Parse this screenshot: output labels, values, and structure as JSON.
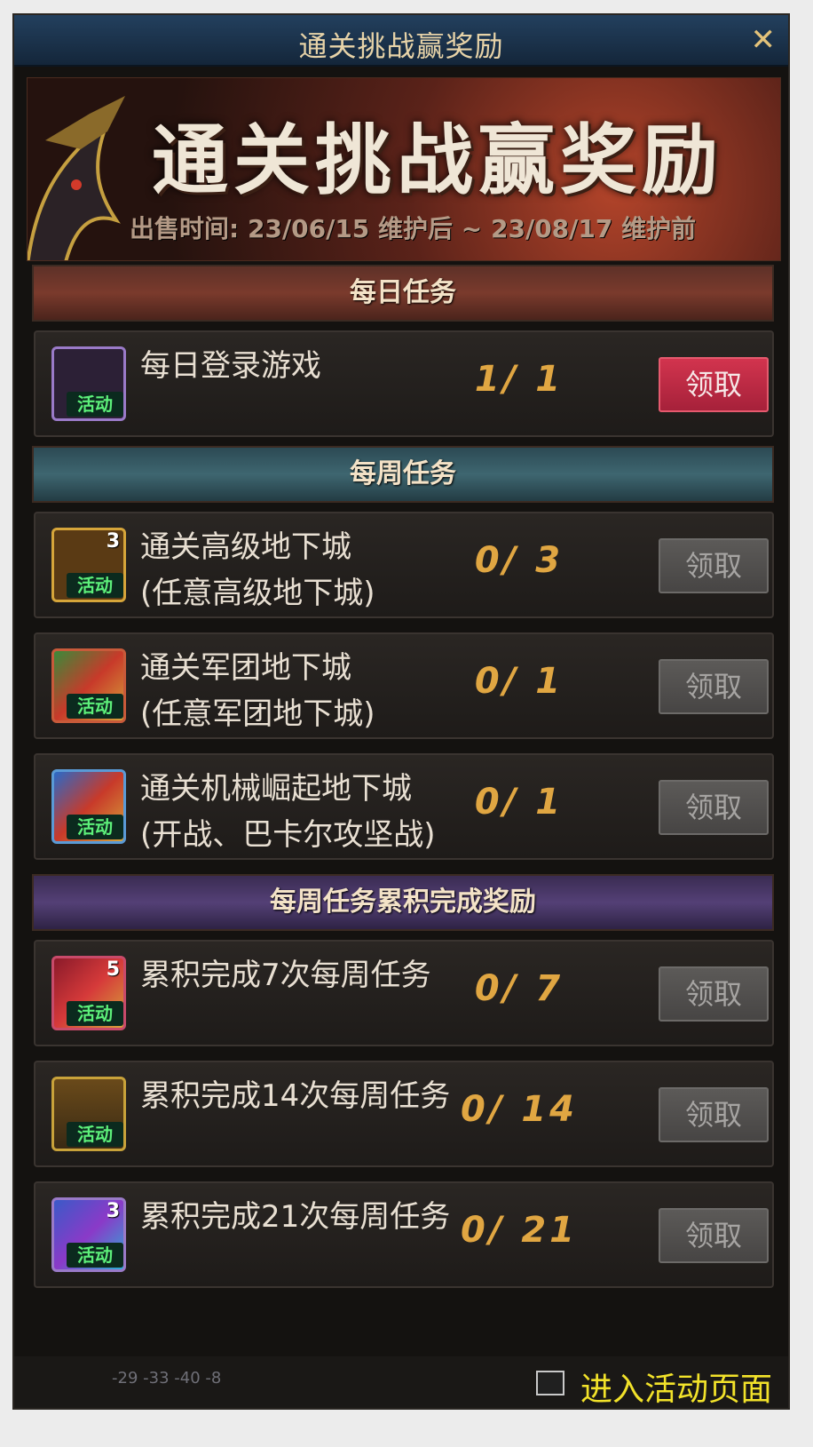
{
  "window": {
    "title": "通关挑战赢奖励",
    "close_glyph": "✕"
  },
  "banner": {
    "title": "通关挑战赢奖励",
    "sale_period": "出售时间: 23/06/15 维护后 ~ 23/08/17 维护前"
  },
  "sections": [
    {
      "title": "每日任务"
    },
    {
      "title": "每周任务"
    },
    {
      "title": "每周任务累积完成奖励"
    }
  ],
  "tasks": [
    {
      "name": "每日登录游戏",
      "sub": "",
      "progress": "1/ 1",
      "button": "领取",
      "icon": "purple-box-icon",
      "badge": "活动",
      "count": ""
    },
    {
      "name": "通关高级地下城",
      "sub": "(任意高级地下城)",
      "progress": "0/ 3",
      "button": "领取",
      "icon": "gold-chest-icon",
      "badge": "活动",
      "count": "3"
    },
    {
      "name": "通关军团地下城",
      "sub": "(任意军团地下城)",
      "progress": "0/ 1",
      "button": "领取",
      "icon": "rainbow-gem-icon",
      "badge": "活动",
      "count": ""
    },
    {
      "name": "通关机械崛起地下城",
      "sub": "(开战、巴卡尔攻坚战)",
      "progress": "0/ 1",
      "button": "领取",
      "icon": "blue-gem-icon",
      "badge": "活动",
      "count": ""
    },
    {
      "name": "累积完成7次每周任务",
      "sub": "",
      "progress": "0/ 7",
      "button": "领取",
      "icon": "red-card-icon",
      "badge": "活动",
      "count": "5"
    },
    {
      "name": "累积完成14次每周任务",
      "sub": "",
      "progress": "0/ 14",
      "button": "领取",
      "icon": "gold-box-icon",
      "badge": "活动",
      "count": ""
    },
    {
      "name": "累积完成21次每周任务",
      "sub": "",
      "progress": "0/ 21",
      "button": "领取",
      "icon": "blue-box-icon",
      "badge": "活动",
      "count": "3"
    }
  ],
  "footer": {
    "enter_label": "进入活动页面",
    "hotbar_text": "-29  -33  -40  -8"
  },
  "colors": {
    "claim_active": "#c62a44",
    "claim_inactive": "#555352",
    "progress": "#e0a642",
    "enter_link": "#f2e22a"
  }
}
